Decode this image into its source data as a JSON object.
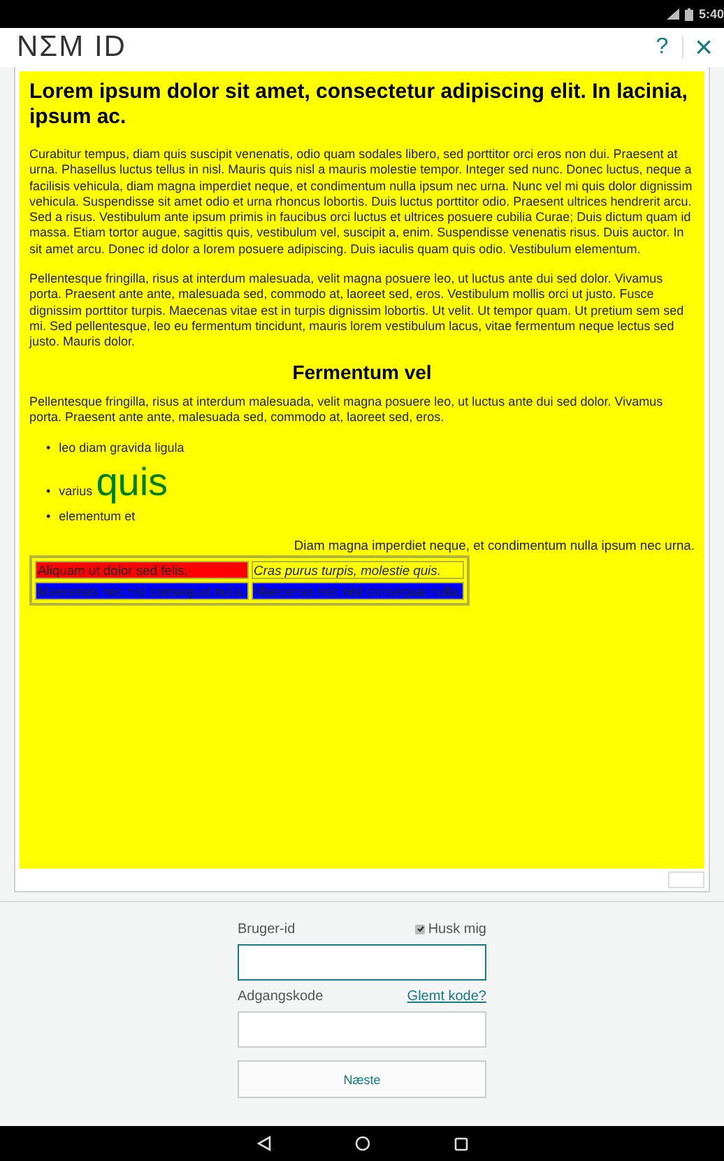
{
  "status_bar": {
    "time": "5:40"
  },
  "header": {
    "logo": "NΣM ID",
    "help": "?",
    "close": "×"
  },
  "content": {
    "title": "Lorem ipsum dolor sit amet, consectetur adipiscing elit. In lacinia, ipsum ac.",
    "paragraphs": [
      "Curabitur tempus, diam quis suscipit venenatis, odio quam sodales libero, sed porttitor orci eros non dui. Praesent at urna. Phasellus luctus tellus in nisl. Mauris quis nisl a mauris molestie tempor. Integer sed nunc. Donec luctus, neque a facilisis vehicula, diam magna imperdiet neque, et condimentum nulla ipsum nec urna. Nunc vel mi quis dolor dignissim vehicula. Suspendisse sit amet odio et urna rhoncus lobortis. Duis luctus porttitor odio. Praesent ultrices hendrerit arcu. Sed a risus. Vestibulum ante ipsum primis in faucibus orci luctus et ultrices posuere cubilia Curae; Duis dictum quam id massa. Etiam tortor augue, sagittis quis, vestibulum vel, suscipit a, enim. Suspendisse venenatis risus. Duis auctor. In sit amet arcu. Donec id dolor a lorem posuere adipiscing. Duis iaculis quam quis odio. Vestibulum elementum.",
      "Pellentesque fringilla, risus at interdum malesuada, velit magna posuere leo, ut luctus ante dui sed dolor. Vivamus porta. Praesent ante ante, malesuada sed, commodo at, laoreet sed, eros. Vestibulum mollis orci ut justo. Fusce dignissim porttitor turpis. Maecenas vitae est in turpis dignissim lobortis. Ut velit. Ut tempor quam. Ut pretium sem sed mi. Sed pellentesque, leo eu fermentum tincidunt, mauris lorem vestibulum lacus, vitae fermentum neque lectus sed justo. Mauris dolor."
    ],
    "subheading": "Fermentum vel",
    "paragraph_2": "Pellentesque fringilla, risus at interdum malesuada, velit magna posuere leo, ut luctus ante dui sed dolor. Vivamus porta. Praesent ante ante, malesuada sed, commodo at, laoreet sed, eros.",
    "list": [
      {
        "marker": "•",
        "text": "leo diam gravida ligula"
      },
      {
        "marker": "•",
        "text": "varius",
        "large_text": "quis"
      },
      {
        "marker": "•",
        "text": "elementum et"
      }
    ],
    "table": {
      "caption": "Diam magna imperdiet neque, et condimentum nulla ipsum nec urna.",
      "rows": [
        [
          {
            "text": "Aliquam ut dolor sed felis.",
            "color": "#ff0000",
            "italic": false
          },
          {
            "text": "Cras purus turpis, molestie quis.",
            "color": "#ffff00",
            "italic": true
          }
        ],
        [
          {
            "text": "Maecenas nec nisl consequat nulla.",
            "color": "#0000ff",
            "italic": false
          },
          {
            "text": "Maecenas nec nisl consequat nulla.",
            "color": "#0000ff",
            "italic": false
          }
        ]
      ]
    }
  },
  "login": {
    "user_label": "Bruger-id",
    "remember": {
      "label": "Husk mig",
      "checked": true
    },
    "password_label": "Adgangskode",
    "forgot_link": "Glemt kode?",
    "next_button": "Næste"
  }
}
